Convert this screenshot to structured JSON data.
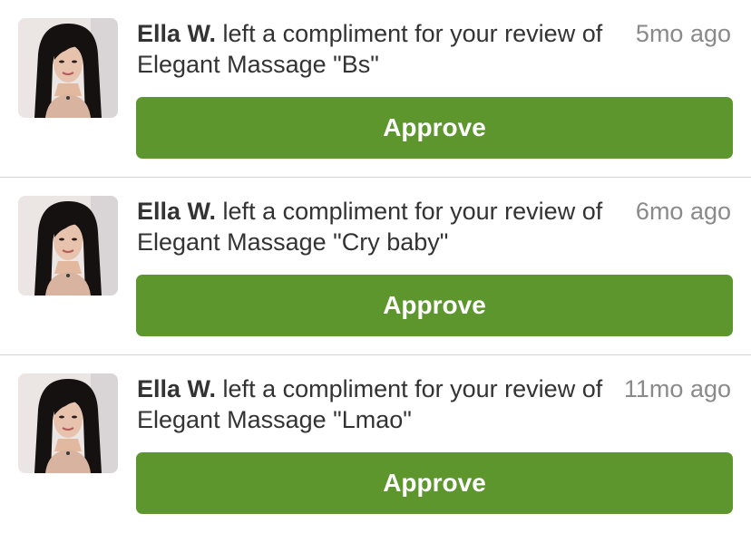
{
  "notifications": [
    {
      "user_name": "Ella W.",
      "message": "left a compliment for your review of Elegant Massage \"Bs\"",
      "time": "5mo ago",
      "action_label": "Approve"
    },
    {
      "user_name": "Ella W.",
      "message": "left a compliment for your review of Elegant Massage \"Cry baby\"",
      "time": "6mo ago",
      "action_label": "Approve"
    },
    {
      "user_name": "Ella W.",
      "message": "left a compliment for your review of Elegant Massage \"Lmao\"",
      "time": "11mo ago",
      "action_label": "Approve"
    }
  ],
  "colors": {
    "approve_button": "#5c962c",
    "divider": "#d3d3d3",
    "timestamp": "#8a8a8a",
    "body_text": "#333333"
  }
}
